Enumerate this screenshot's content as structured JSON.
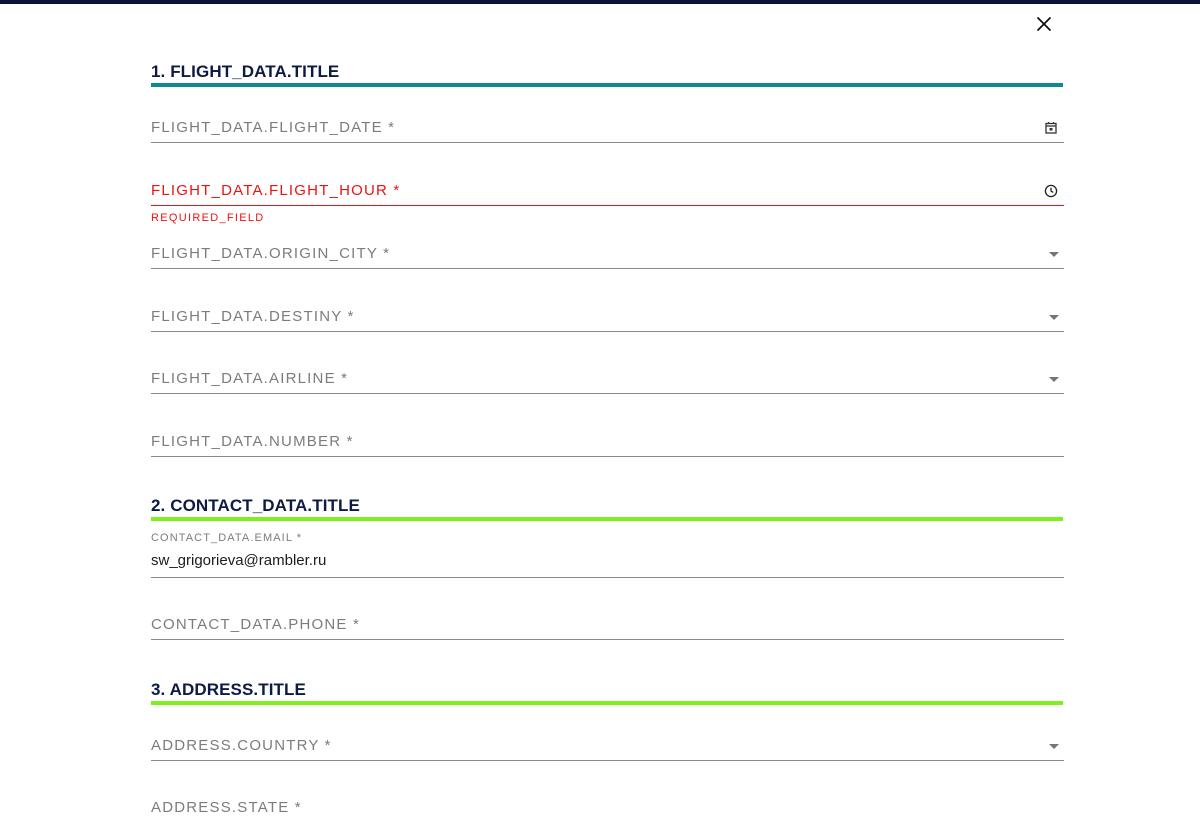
{
  "colors": {
    "top_bar": "#0d1433",
    "section_1_accent": "#11888f",
    "section_2_accent": "#7fef1f",
    "section_3_accent": "#7fef1f",
    "error": "#ee1111"
  },
  "close_icon": "close-icon",
  "sections": {
    "flight": {
      "title": "1. FLIGHT_DATA.TITLE"
    },
    "contact": {
      "title": "2. CONTACT_DATA.TITLE"
    },
    "address": {
      "title": "3. ADDRESS.TITLE"
    }
  },
  "fields": {
    "flight_date": {
      "label": "FLIGHT_DATA.FLIGHT_DATE *",
      "icon": "calendar-icon"
    },
    "flight_hour": {
      "label": "FLIGHT_DATA.FLIGHT_HOUR *",
      "icon": "clock-icon",
      "error": "REQUIRED_FIELD"
    },
    "origin_city": {
      "label": "FLIGHT_DATA.ORIGIN_CITY *",
      "icon": "dropdown-arrow-icon"
    },
    "destiny": {
      "label": "FLIGHT_DATA.DESTINY *",
      "icon": "dropdown-arrow-icon"
    },
    "airline": {
      "label": "FLIGHT_DATA.AIRLINE *",
      "icon": "dropdown-arrow-icon"
    },
    "number": {
      "label": "FLIGHT_DATA.NUMBER *"
    },
    "email": {
      "label": "CONTACT_DATA.EMAIL *",
      "value": "sw_grigorieva@rambler.ru"
    },
    "phone": {
      "label": "CONTACT_DATA.PHONE *"
    },
    "country": {
      "label": "ADDRESS.COUNTRY *",
      "icon": "dropdown-arrow-icon"
    },
    "state": {
      "label": "ADDRESS.STATE *"
    }
  }
}
